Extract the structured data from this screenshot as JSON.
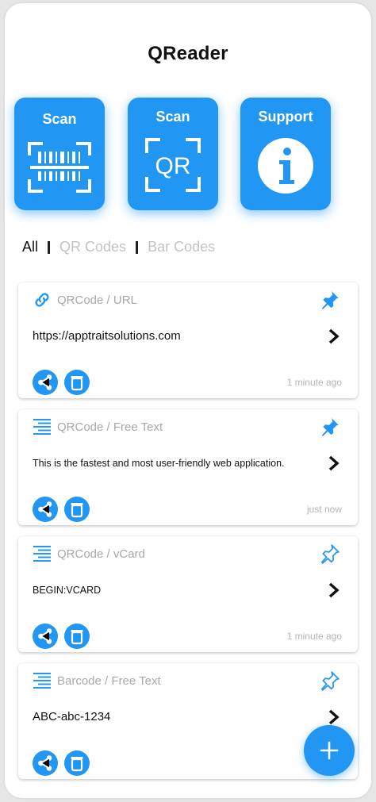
{
  "app": {
    "title": "QReader"
  },
  "tiles": {
    "scan_barcode": {
      "label": "Scan",
      "icon": "barcode-scan-icon"
    },
    "scan_qr": {
      "label": "Scan",
      "icon": "qr-scan-icon",
      "icon_text": "QR"
    },
    "support": {
      "label": "Support",
      "icon": "info-icon"
    }
  },
  "filters": {
    "all": "All",
    "qr_codes": "QR Codes",
    "bar_codes": "Bar Codes",
    "active": "All"
  },
  "colors": {
    "accent": "#2196F3",
    "text_primary": "#111111",
    "text_muted": "#a8a8a8"
  },
  "history": [
    {
      "kind": "QRCode",
      "type": "URL",
      "icon": "link-icon",
      "pinned": true,
      "content": "https://apptraitsolutions.com",
      "time": "1 minute ago"
    },
    {
      "kind": "QRCode",
      "type": "Free Text",
      "icon": "text-lines-icon",
      "pinned": true,
      "content": "This is the fastest and most user-friendly web application.",
      "time": "just now"
    },
    {
      "kind": "QRCode",
      "type": "vCard",
      "icon": "text-lines-icon",
      "pinned": false,
      "content": "BEGIN:VCARD",
      "time": "1 minute ago"
    },
    {
      "kind": "Barcode",
      "type": "Free Text",
      "icon": "text-lines-icon",
      "pinned": false,
      "content": "ABC-abc-1234",
      "time": ""
    }
  ],
  "fab": {
    "icon": "plus-icon"
  }
}
